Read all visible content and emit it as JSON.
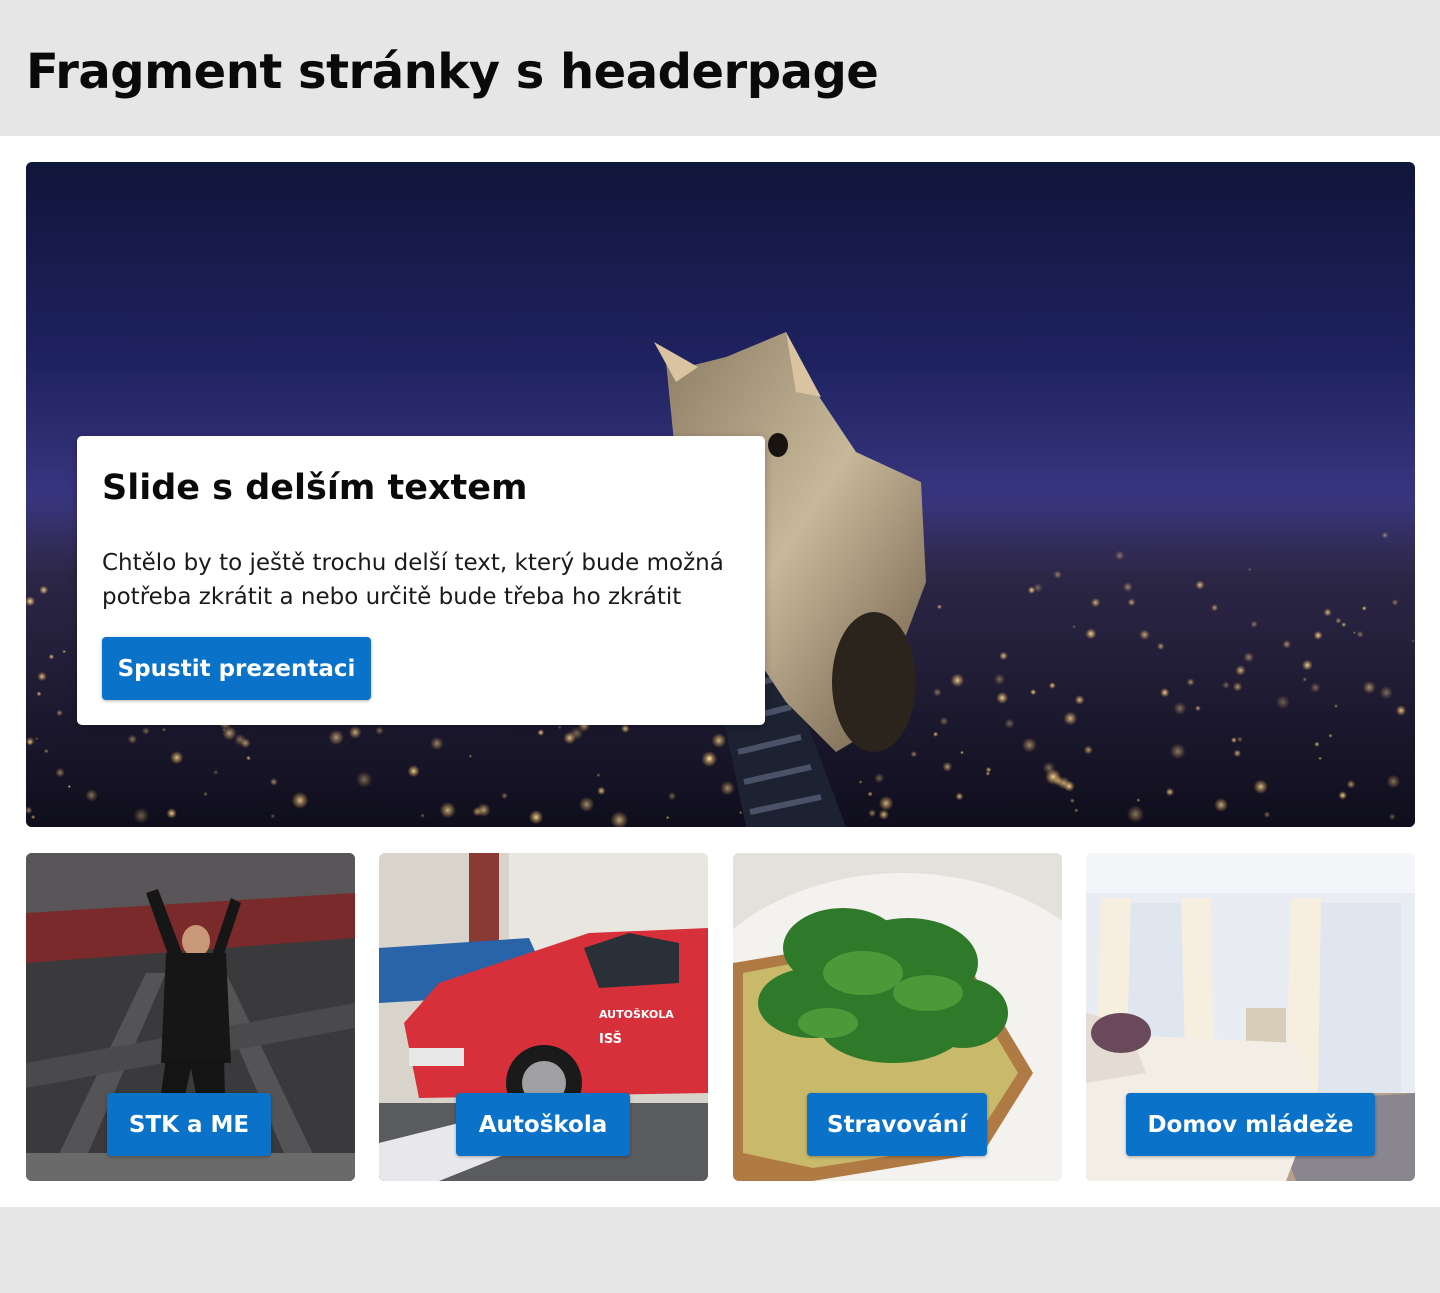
{
  "header": {
    "title": "Fragment stránky s headerpage"
  },
  "hero": {
    "image_icon": "cat-city-night-photo",
    "title": "Slide s delším textem",
    "text": "Chtělo by to ještě trochu delší text, který bude možná potřeba zkrátit a nebo určitě bude třeba ho zkrátit",
    "button_label": "Spustit prezentaci"
  },
  "tiles": [
    {
      "label": "STK a ME",
      "image_icon": "mechanic-under-car-photo"
    },
    {
      "label": "Autoškola",
      "image_icon": "red-car-photo"
    },
    {
      "label": "Stravování",
      "image_icon": "avocado-toast-photo"
    },
    {
      "label": "Domov mládeže",
      "image_icon": "bedroom-photo"
    }
  ],
  "colors": {
    "accent": "#0a72c8",
    "header_bg": "#e6e6e6",
    "main_bg": "#ffffff"
  }
}
